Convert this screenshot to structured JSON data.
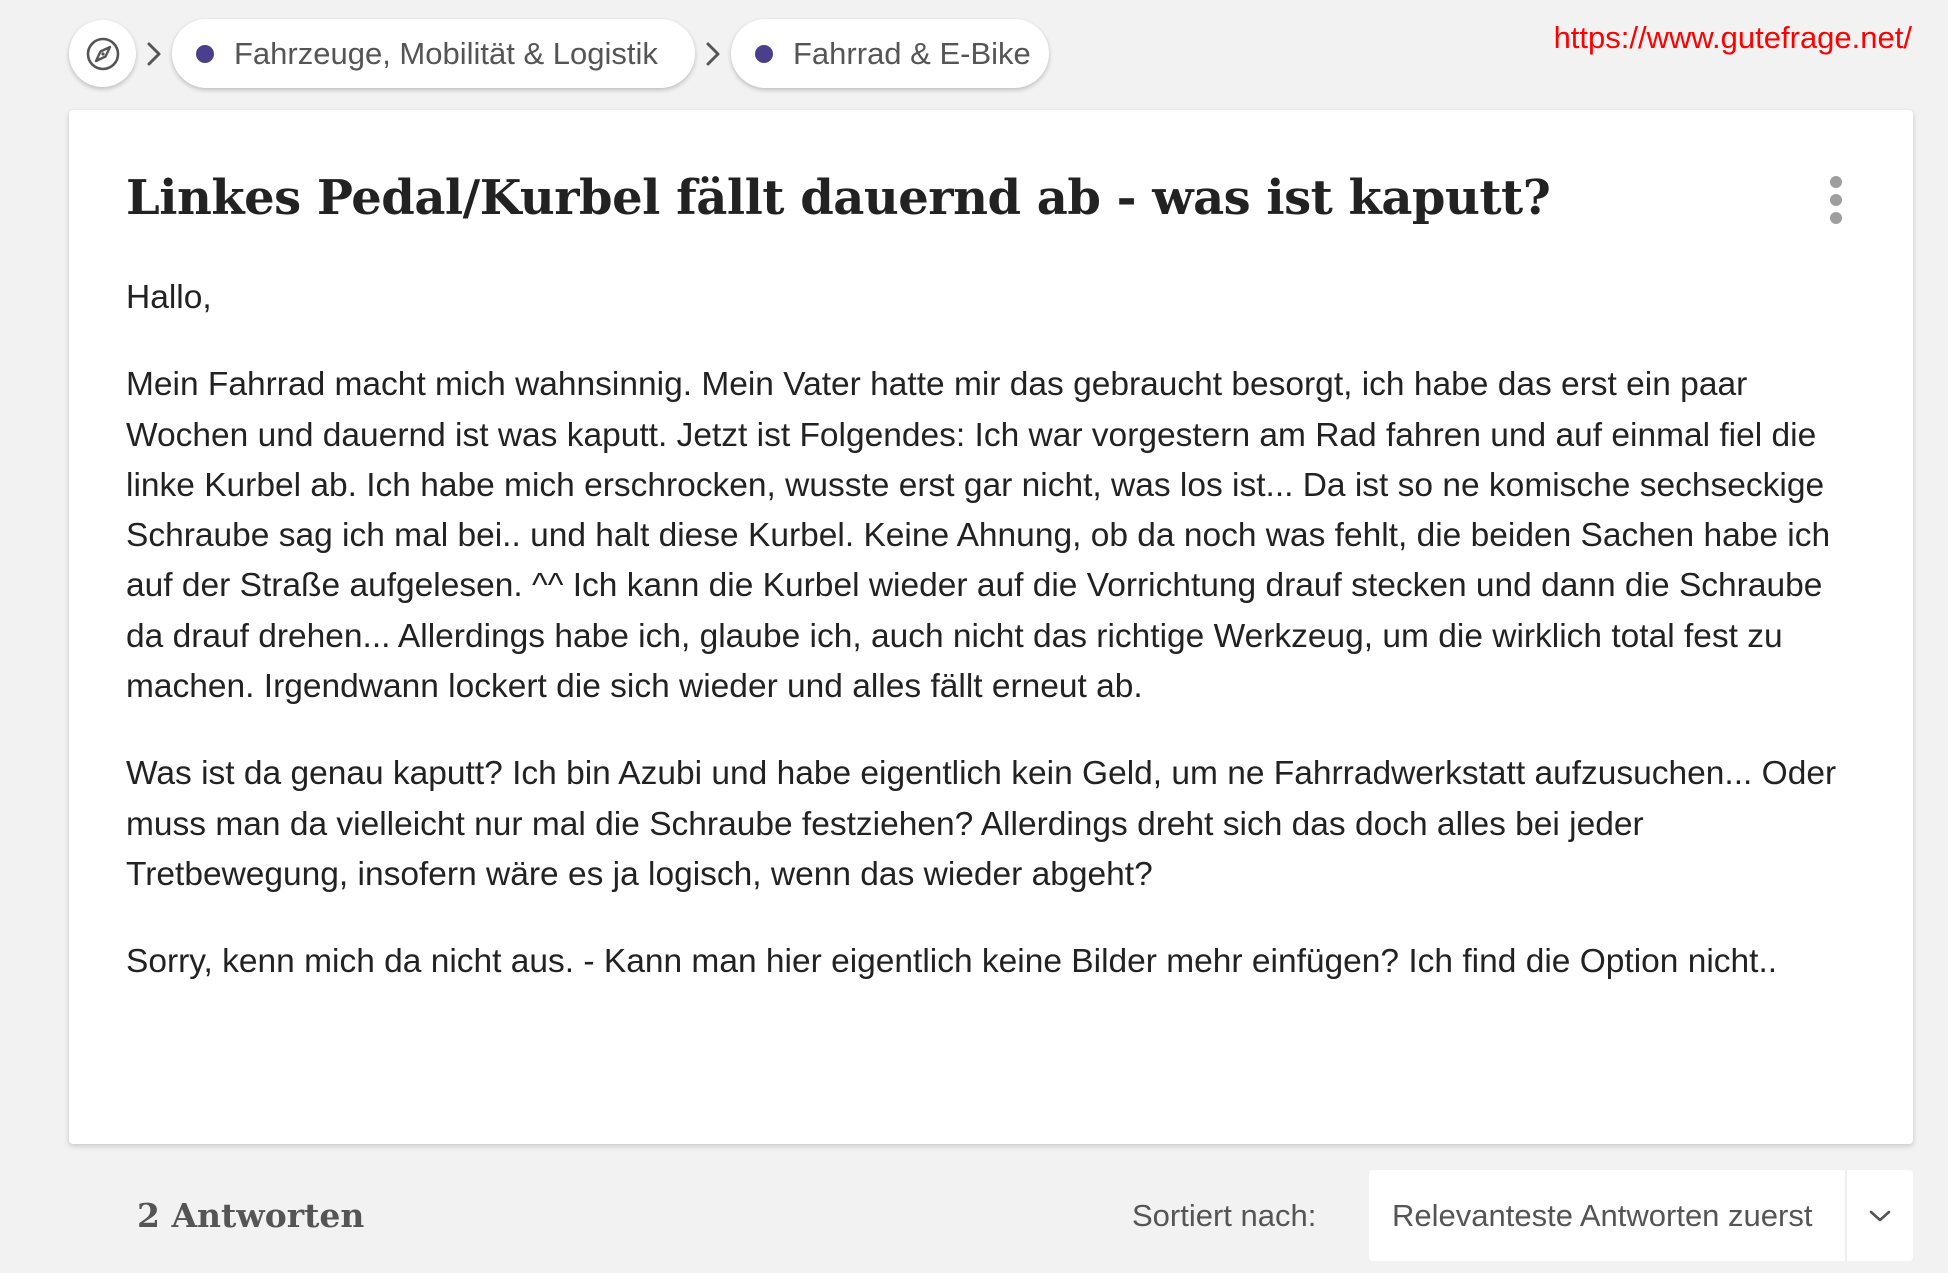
{
  "breadcrumb": {
    "home_icon": "compass-icon",
    "separator_icon": "chevron-right-icon",
    "items": [
      {
        "label": "Fahrzeuge, Mobilität & Logistik",
        "dot_color": "#4a3f8c"
      },
      {
        "label": "Fahrrad & E-Bike",
        "dot_color": "#4a3f8c"
      }
    ]
  },
  "url_overlay": "https://www.gutefrage.net/",
  "question": {
    "title": "Linkes Pedal/Kurbel fällt dauernd ab - was ist kaputt?",
    "menu_icon": "more-vertical-icon",
    "paragraphs": [
      "Hallo,",
      "Mein Fahrrad macht mich wahnsinnig. Mein Vater hatte mir das gebraucht besorgt, ich habe das erst ein paar Wochen und dauernd ist was kaputt. Jetzt ist Folgendes: Ich war vorgestern am Rad fahren und auf einmal fiel die linke Kurbel ab. Ich habe mich erschrocken, wusste erst gar nicht, was los ist... Da ist so ne komische sechseckige Schraube sag ich mal bei.. und halt diese Kurbel. Keine Ahnung, ob da noch was fehlt, die beiden Sachen habe ich auf der Straße aufgelesen. ^^ Ich kann die Kurbel wieder auf die Vorrichtung drauf stecken und dann die Schraube da drauf drehen... Allerdings habe ich, glaube ich, auch nicht das richtige Werkzeug, um die wirklich total fest zu machen. Irgendwann lockert die sich wieder und alles fällt erneut ab.",
      "Was ist da genau kaputt? Ich bin Azubi und habe eigentlich kein Geld, um ne Fahrradwerkstatt aufzusuchen... Oder muss man da vielleicht nur mal die Schraube festziehen? Allerdings dreht sich das doch alles bei jeder Tretbewegung, insofern wäre es ja logisch, wenn das wieder abgeht?",
      "Sorry, kenn mich da nicht aus. - Kann man hier eigentlich keine Bilder mehr einfügen? Ich find die Option nicht.."
    ]
  },
  "answers": {
    "count_label": "2 Antworten",
    "sort_label": "Sortiert nach:",
    "sort_value": "Relevanteste Antworten zuerst",
    "sort_icon": "chevron-down-icon"
  }
}
